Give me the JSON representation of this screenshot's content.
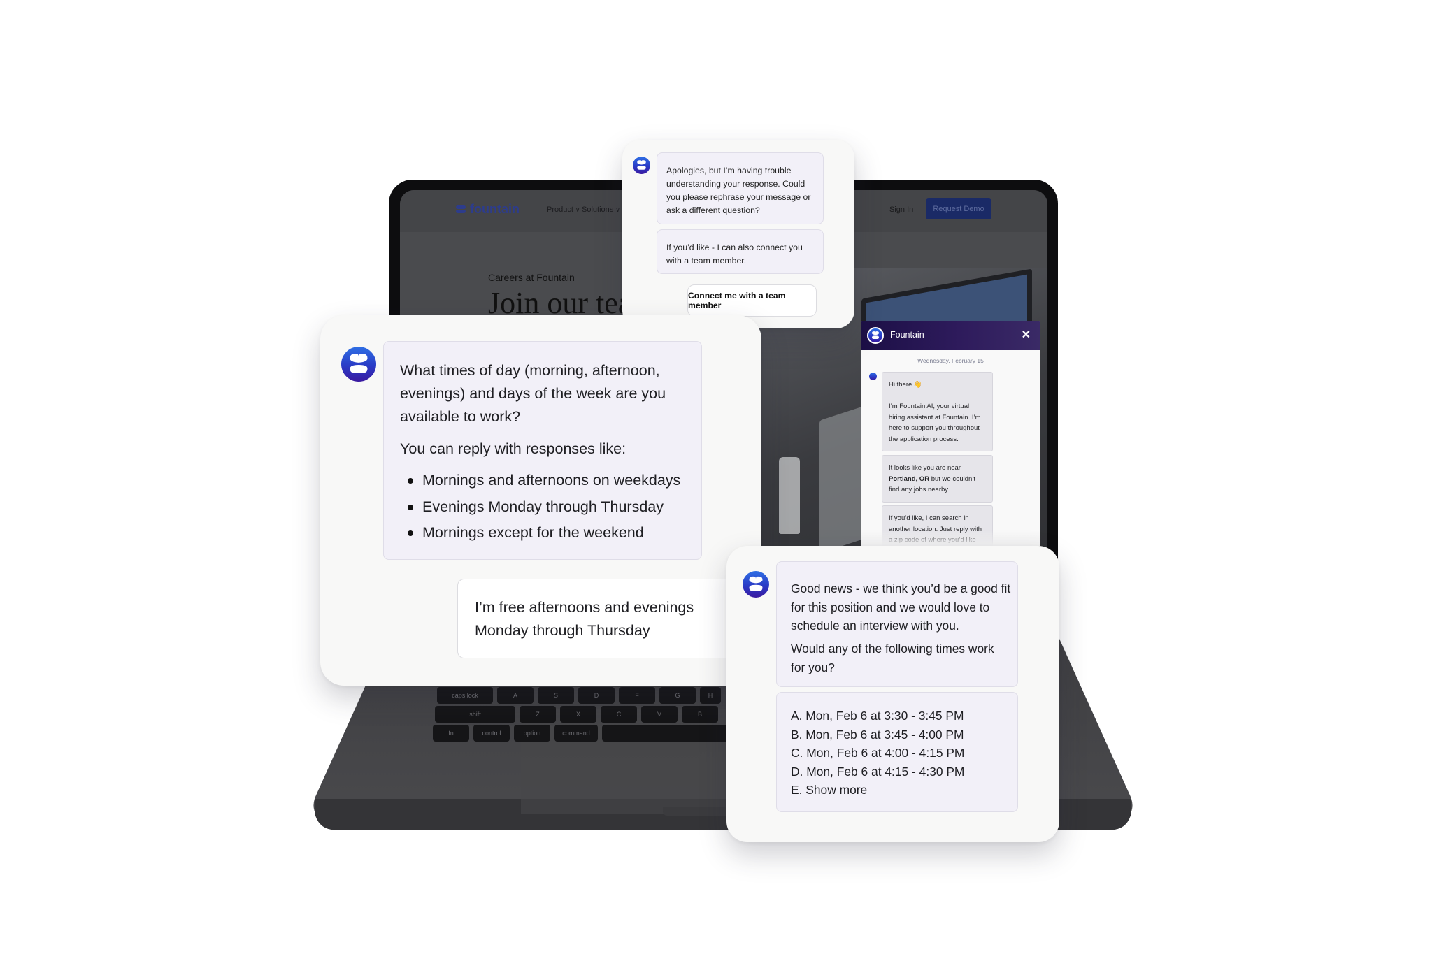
{
  "laptop_site": {
    "logo_text": "fountain",
    "nav": [
      {
        "label": "Product"
      },
      {
        "label": "Solutions"
      }
    ],
    "sign_in": "Sign In",
    "request_demo": "Request Demo",
    "eyebrow": "Careers at Fountain",
    "headline": "Join our tea",
    "keyboard": {
      "row1": [
        "caps lock",
        "A",
        "S",
        "D",
        "F",
        "G",
        "H"
      ],
      "row2": [
        "shift",
        "Z",
        "X",
        "C",
        "V",
        "B"
      ],
      "row3": [
        "fn",
        "control",
        "option",
        "command"
      ]
    }
  },
  "top_card": {
    "message_1": "Apologies, but I’m having trouble understanding your response. Could you please rephrase your message or ask a different question?",
    "message_2": "If you’d like - I can also connect you with a team member.",
    "button": "Connect me with a team member"
  },
  "availability_card": {
    "question": "What times of day (morning, afternoon, evenings) and days of the week are you available to work?",
    "hint": "You can reply with responses like:",
    "examples": [
      "Mornings and afternoons on weekdays",
      "Evenings Monday through Thursday",
      "Mornings except for the weekend"
    ],
    "user_reply": "I’m free afternoons and evenings Monday through Thursday"
  },
  "widget": {
    "title": "Fountain",
    "close_icon": "✕",
    "date": "Wednesday, February 15",
    "greeting": "Hi there 👋",
    "intro": "I’m Fountain AI, your virtual hiring assistant at Fountain. I’m here to support you throughout the application process.",
    "location_pre": "It looks like you are near ",
    "location_bold": "Portland, OR",
    "location_post": " but we couldn’t find any jobs nearby.",
    "search_prompt": "If you’d like, I can search in another location. Just reply with a zip code of where you’d like me to look."
  },
  "schedule_card": {
    "message_1": "Good news - we think you’d be a good fit for this position and we would love to schedule an interview with you.",
    "message_2": "Would any of the following times work for you?",
    "options": [
      "A. Mon, Feb 6 at 3:30 - 3:45 PM",
      "B. Mon, Feb 6 at 3:45 - 4:00 PM",
      "C. Mon, Feb 6 at 4:00 - 4:15 PM",
      "D. Mon, Feb 6 at 4:15 - 4:30 PM",
      "E. Show more"
    ]
  },
  "colors": {
    "brand_navy": "#2d3c8c",
    "demo_button": "#1a2a66",
    "widget_header": "#2a1957",
    "bot_bubble": "#f2f0f8",
    "card_bg": "#f8f8f7"
  }
}
